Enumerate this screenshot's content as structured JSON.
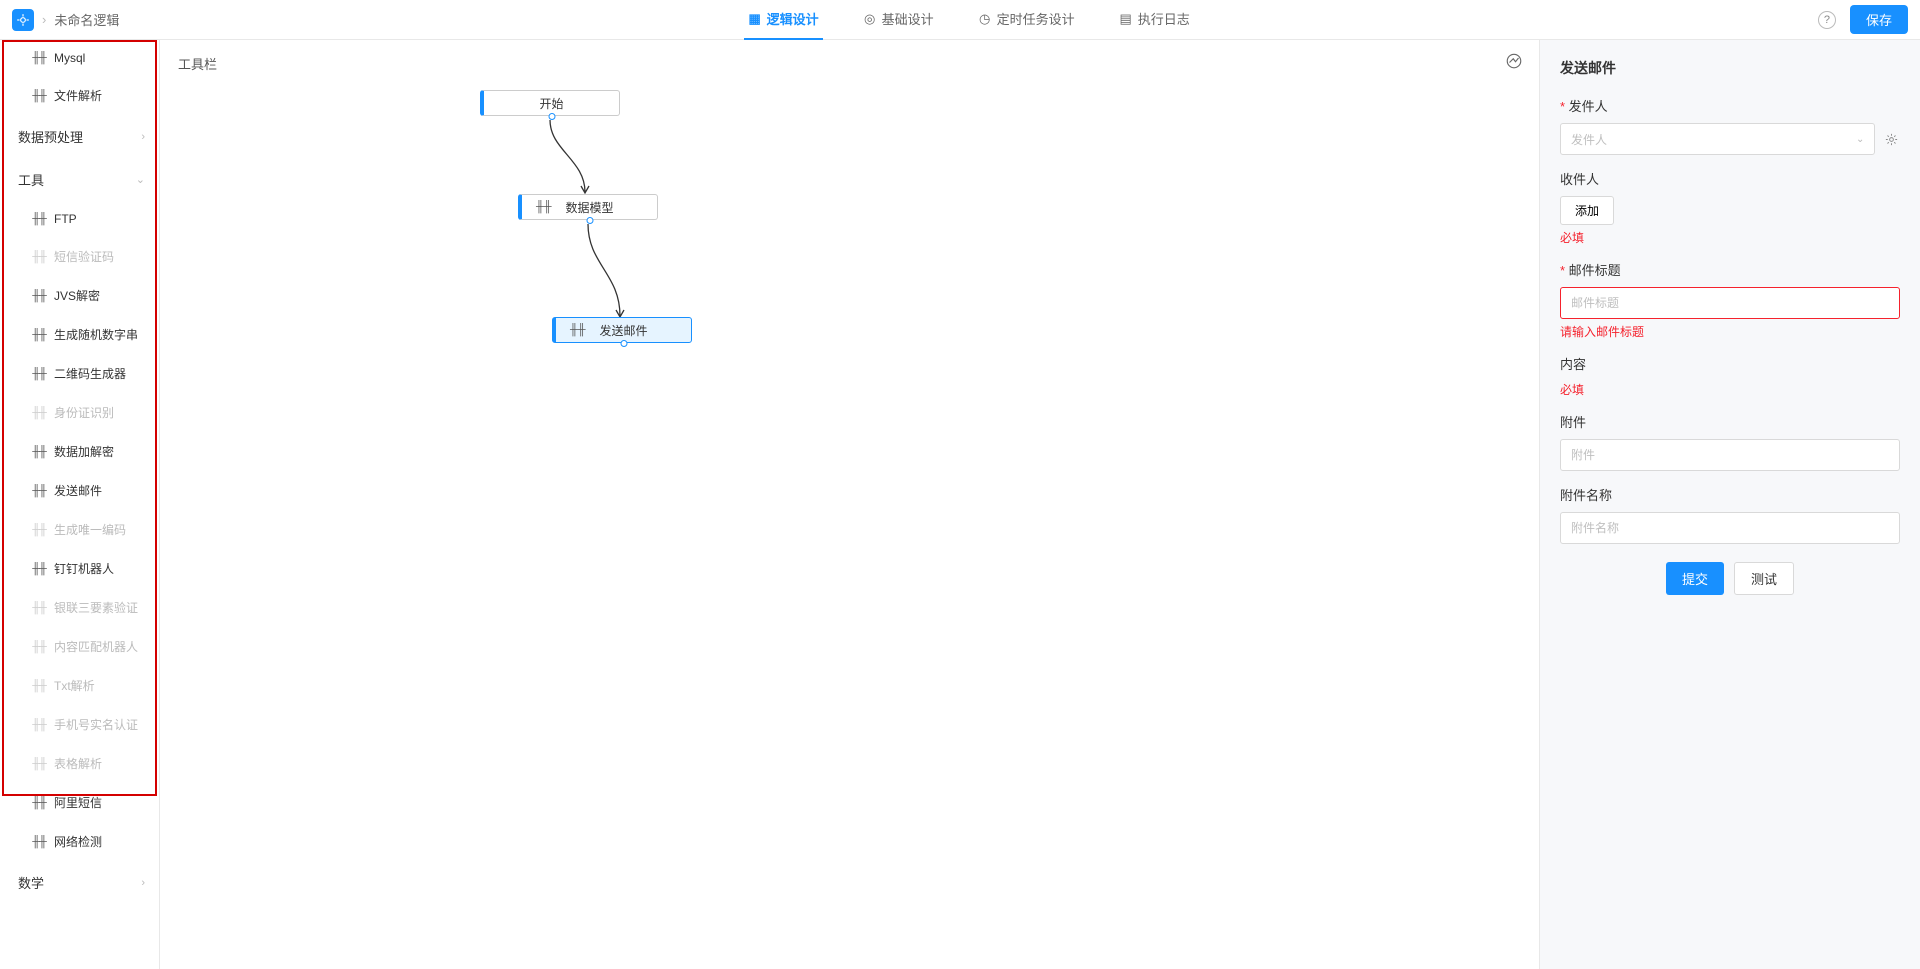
{
  "header": {
    "breadcrumb": "未命名逻辑",
    "tabs": [
      {
        "label": "逻辑设计",
        "active": true
      },
      {
        "label": "基础设计",
        "active": false
      },
      {
        "label": "定时任务设计",
        "active": false
      },
      {
        "label": "执行日志",
        "active": false
      }
    ],
    "save_label": "保存"
  },
  "sidebar": {
    "top_items": [
      {
        "label": "Mysql",
        "muted": false
      },
      {
        "label": "文件解析",
        "muted": false
      }
    ],
    "groups": [
      {
        "label": "数据预处理",
        "expanded": false
      },
      {
        "label": "工具",
        "expanded": true
      }
    ],
    "tool_items": [
      {
        "label": "FTP",
        "muted": false
      },
      {
        "label": "短信验证码",
        "muted": true
      },
      {
        "label": "JVS解密",
        "muted": false
      },
      {
        "label": "生成随机数字串",
        "muted": false
      },
      {
        "label": "二维码生成器",
        "muted": false
      },
      {
        "label": "身份证识别",
        "muted": true
      },
      {
        "label": "数据加解密",
        "muted": false
      },
      {
        "label": "发送邮件",
        "muted": false
      },
      {
        "label": "生成唯一编码",
        "muted": true
      },
      {
        "label": "钉钉机器人",
        "muted": false
      },
      {
        "label": "银联三要素验证",
        "muted": true
      },
      {
        "label": "内容匹配机器人",
        "muted": true
      },
      {
        "label": "Txt解析",
        "muted": true
      },
      {
        "label": "手机号实名认证",
        "muted": true
      },
      {
        "label": "表格解析",
        "muted": true
      },
      {
        "label": "阿里短信",
        "muted": false
      },
      {
        "label": "网络检测",
        "muted": false
      }
    ],
    "bottom_group": {
      "label": "数学"
    }
  },
  "canvas": {
    "toolbar_label": "工具栏",
    "nodes": {
      "start": "开始",
      "data_model": "数据模型",
      "send_mail": "发送邮件"
    }
  },
  "panel": {
    "title": "发送邮件",
    "sender": {
      "label": "发件人",
      "placeholder": "发件人"
    },
    "recipient": {
      "label": "收件人",
      "add_label": "添加",
      "error": "必填"
    },
    "subject": {
      "label": "邮件标题",
      "placeholder": "邮件标题",
      "error": "请输入邮件标题"
    },
    "content": {
      "label": "内容",
      "error": "必填"
    },
    "attachment": {
      "label": "附件",
      "placeholder": "附件"
    },
    "attachment_name": {
      "label": "附件名称",
      "placeholder": "附件名称"
    },
    "submit_label": "提交",
    "test_label": "测试"
  }
}
